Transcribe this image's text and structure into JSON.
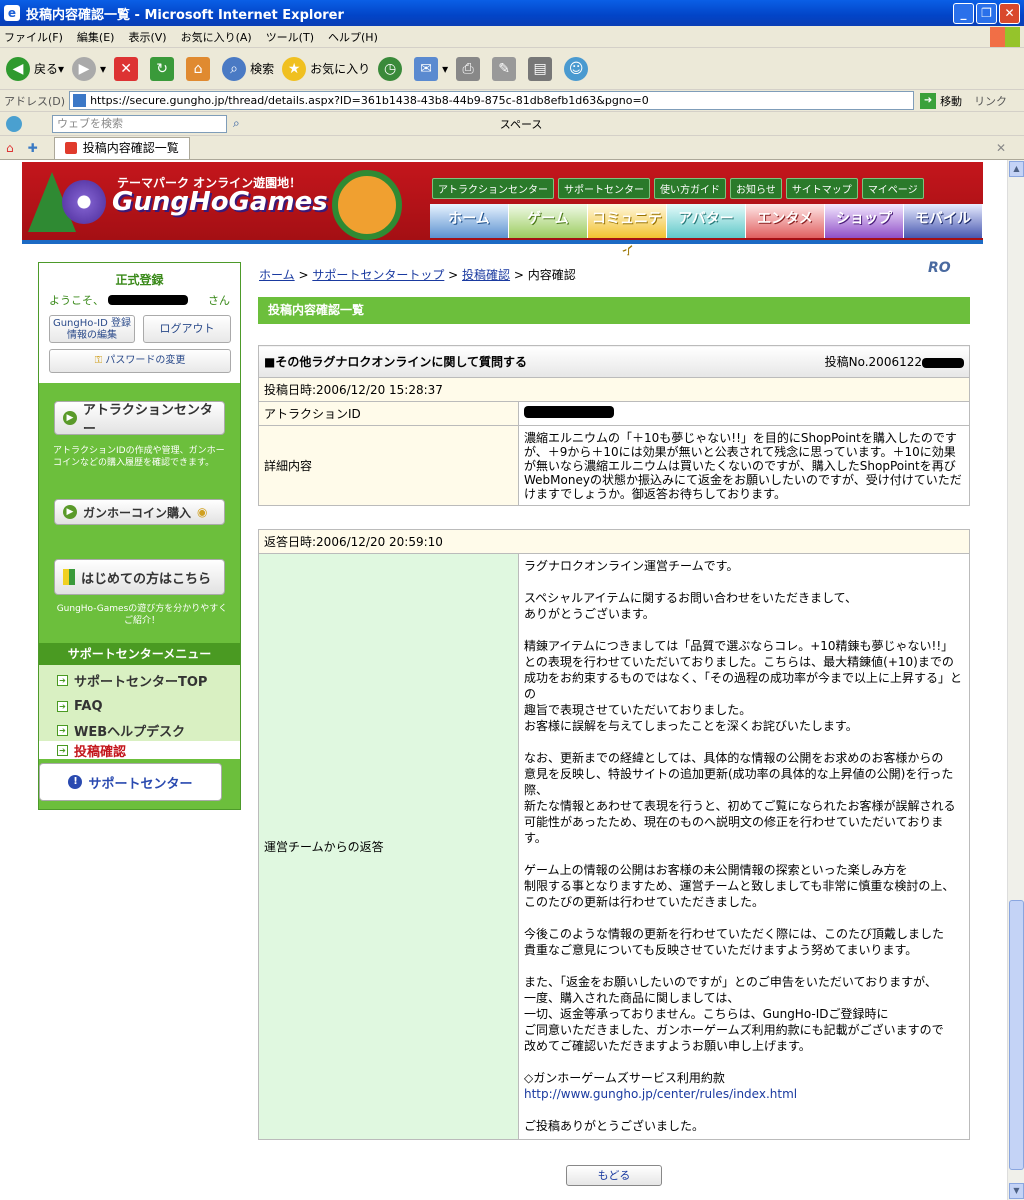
{
  "window": {
    "title": "投稿内容確認一覧 - Microsoft Internet Explorer"
  },
  "menu": [
    "ファイル(F)",
    "編集(E)",
    "表示(V)",
    "お気に入り(A)",
    "ツール(T)",
    "ヘルプ(H)"
  ],
  "toolbar": {
    "back": "戻る",
    "search": "検索",
    "favorites": "お気に入り"
  },
  "address": {
    "label": "アドレス(D)",
    "url": "https://secure.gungho.jp/thread/details.aspx?ID=361b1438-43b8-44b9-875c-81db8efb1d63&pgno=0",
    "go": "移動",
    "links": "リンク"
  },
  "searchbar": {
    "placeholder": "ウェブを検索",
    "space": "スペース"
  },
  "tab": {
    "title": "投稿内容確認一覧"
  },
  "site": {
    "tagline": "テーマパーク オンライン遊園地！",
    "logo": "GungHoGames",
    "topnav": [
      "アトラクションセンター",
      "サポートセンター",
      "使い方ガイド",
      "お知らせ",
      "サイトマップ",
      "マイページ"
    ],
    "gnav": [
      "ホーム",
      "ゲーム",
      "コミュニティ",
      "アバター",
      "エンタメ",
      "ショップ",
      "モバイル"
    ]
  },
  "sidebar": {
    "status": "正式登録",
    "welcome_pre": "ようこそ、",
    "welcome_post": "さん",
    "id_edit": "GungHo-ID 登録情報の編集",
    "logout": "ログアウト",
    "password": "パスワードの変更",
    "attraction_btn": "アトラクションセンター",
    "attraction_text": "アトラクションIDの作成や管理、ガンホーコインなどの購入履歴を確認できます。",
    "coin_btn": "ガンホーコイン購入",
    "beginner_btn": "はじめての方はこちら",
    "beginner_text": "GungHo-Gamesの遊び方を分かりやすくご紹介！",
    "menu_head": "サポートセンターメニュー",
    "menu": [
      "サポートセンターTOP",
      "FAQ",
      "WEBヘルプデスク",
      "投稿確認"
    ],
    "support_btn": "サポートセンター"
  },
  "breadcrumb": {
    "home": "ホーム",
    "support_top": "サポートセンタートップ",
    "post_confirm": "投稿確認",
    "current": "内容確認",
    "sep": " > "
  },
  "section_title": "投稿内容確認一覧",
  "question": {
    "category": "■その他ラグナロクオンラインに関して質問する",
    "post_no": "投稿No.2006122",
    "date": "投稿日時:2006/12/20 15:28:37",
    "attraction_label": "アトラクションID",
    "detail_label": "詳細内容",
    "detail": "濃縮エルニウムの「＋10も夢じゃない!!」を目的にShopPointを購入したのですが、＋9から＋10には効果が無いと公表されて残念に思っています。＋10に効果が無いなら濃縮エルニウムは買いたくないのですが、購入したShopPointを再びWebMoneyの状態か振込みにて返金をお願いしたいのですが、受け付けていただけますでしょうか。御返答お待ちしております。"
  },
  "reply": {
    "date": "返答日時:2006/12/20 20:59:10",
    "label": "運営チームからの返答",
    "paragraphs": [
      "ラグナロクオンライン運営チームです。",
      "スペシャルアイテムに関するお問い合わせをいただきまして、\nありがとうございます。",
      "精錬アイテムにつきましては「品質で選ぶならコレ。+10精錬も夢じゃない!!」\nとの表現を行わせていただいておりました。こちらは、最大精錬値(+10)までの\n成功をお約束するものではなく、「その過程の成功率が今まで以上に上昇する」との\n趣旨で表現させていただいておりました。\nお客様に誤解を与えてしまったことを深くお詫びいたします。",
      "なお、更新までの経緯としては、具体的な情報の公開をお求めのお客様からの\n意見を反映し、特設サイトの追加更新(成功率の具体的な上昇値の公開)を行った際、\n新たな情報とあわせて表現を行うと、初めてご覧になられたお客様が誤解される\n可能性があったため、現在のものへ説明文の修正を行わせていただいております。",
      "ゲーム上の情報の公開はお客様の未公開情報の探索といった楽しみ方を\n制限する事となりますため、運営チームと致しましても非常に慎重な検討の上、\nこのたびの更新は行わせていただきました。",
      "今後このような情報の更新を行わせていただく際には、このたび頂戴しました\n貴重なご意見についても反映させていただけますよう努めてまいります。",
      "また、「返金をお願いしたいのですが」とのご申告をいただいておりますが、\n一度、購入された商品に関しましては、\n一切、返金等承っておりません。こちらは、GungHo-IDご登録時に\nご同意いただきました、ガンホーゲームズ利用約款にも記載がございますので\n改めてご確認いただきますようお願い申し上げます。"
    ],
    "terms_title": "◇ガンホーゲームズサービス利用約款",
    "terms_url": "http://www.gungho.jp/center/rules/index.html",
    "closing": "ご投稿ありがとうございました。"
  },
  "back_button": "もどる"
}
